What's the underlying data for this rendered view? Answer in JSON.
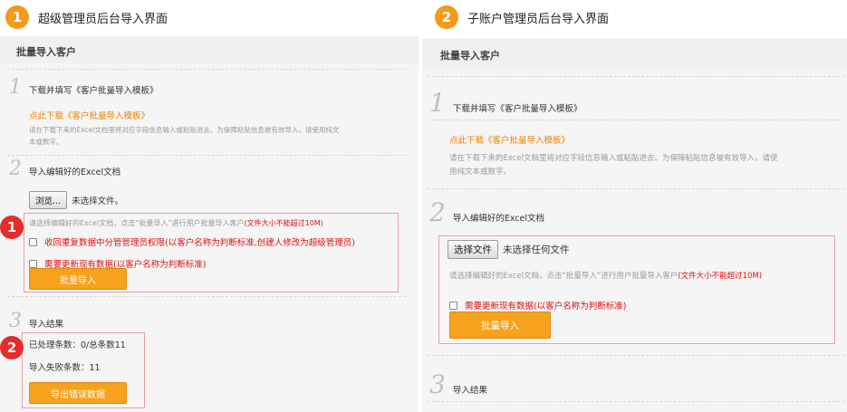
{
  "left": {
    "header_num": "1",
    "header_title": "超级管理员后台导入界面",
    "panel_title": "批量导入客户",
    "step1": {
      "num": "1",
      "label": "下载并填写《客户批量导入模板》"
    },
    "download_link": "点此下载《客户批量导入模板》",
    "hint1_line1": "请在下载下来的Excel文档里将对应字段信息输入或粘贴进去。为保障粘贴信息被有效导入，请使用纯文",
    "hint1_line2": "本或数字。",
    "step2": {
      "num": "2",
      "label": "导入编辑好的Excel文档"
    },
    "browse_label": "浏览...",
    "no_file": "未选择文件。",
    "hint2_prefix": "请选择编辑好的Excel文档，点击“批量导入”进行用户批量导入客户",
    "hint2_limit": "(文件大小不能超过10M)",
    "check1": "收回重复数据中分管管理员权限(以客户名称为判断标准,创建人修改为超级管理员)",
    "check2": "需要更新现有数据(以客户名称为判断标准)",
    "import_button": "批量导入",
    "marker1": "1",
    "marker2": "2",
    "step3": {
      "num": "3",
      "label": "导入结果"
    },
    "processed": "已处理条数：0/总条数11",
    "failed": "导入失败条数：11",
    "export_button": "导出错误数据"
  },
  "right": {
    "header_num": "2",
    "header_title": "子账户管理员后台导入界面",
    "panel_title": "批量导入客户",
    "step1": {
      "num": "1",
      "label": "下载并填写《客户批量导入模板》"
    },
    "download_link": "点此下载《客户批量导入模板》",
    "hint1_line1": "请在下载下来的Excel文档里将对应字段信息输入或粘贴进去。为保障粘贴信息被有效导入，请使",
    "hint1_line2": "用纯文本或数字。",
    "step2": {
      "num": "2",
      "label": "导入编辑好的Excel文档"
    },
    "choose_file": "选择文件",
    "no_file": "未选择任何文件",
    "hint2_prefix": "请选择编辑好的Excel文档，点击“批量导入”进行用户批量导入客户",
    "hint2_limit": "(文件大小不能超过10M)",
    "check2": "需要更新现有数据(以客户名称为判断标准)",
    "import_button": "批量导入",
    "step3": {
      "num": "3",
      "label": "导入结果"
    }
  }
}
